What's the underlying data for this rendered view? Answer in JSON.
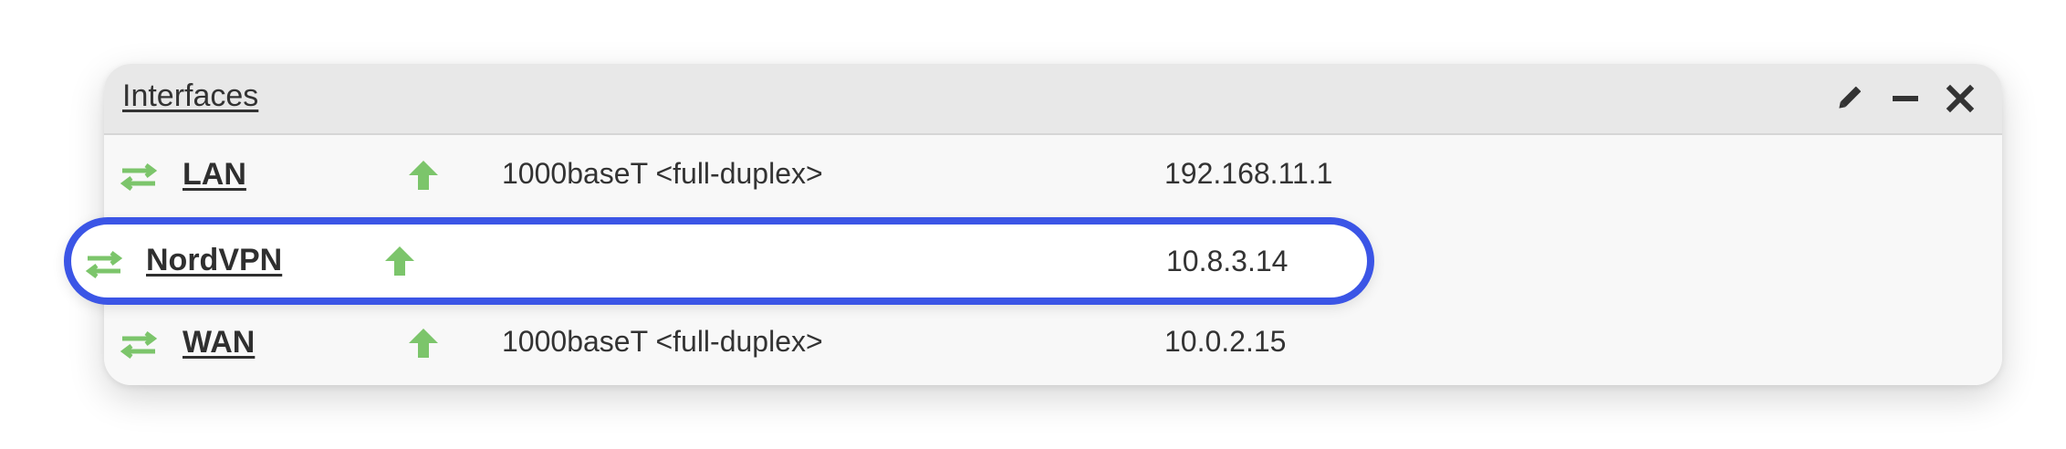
{
  "widget": {
    "title": "Interfaces",
    "controls": {
      "edit_icon": "pencil-icon",
      "minimize_icon": "minus-icon",
      "close_icon": "close-icon"
    }
  },
  "interfaces": [
    {
      "name": "LAN",
      "status": "up",
      "media": "1000baseT <full-duplex>",
      "ip": "192.168.11.1"
    },
    {
      "name": "NordVPN",
      "status": "up",
      "media": "",
      "ip": "10.8.3.14",
      "highlighted": true
    },
    {
      "name": "WAN",
      "status": "up",
      "media": "1000baseT <full-duplex>",
      "ip": "10.0.2.15"
    }
  ],
  "colors": {
    "status_up": "#7cc56b",
    "highlight_border": "#3b55e6",
    "header_bg": "#e8e8e8"
  }
}
